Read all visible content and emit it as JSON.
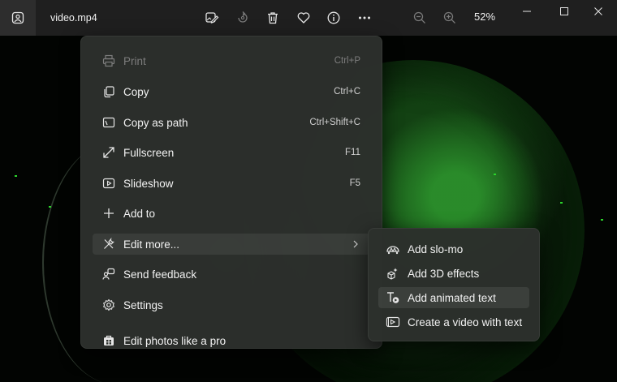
{
  "window": {
    "file_name": "video.mp4",
    "zoom_level": "52%"
  },
  "toolbar": {
    "icons": [
      "edit-image-icon",
      "rotate-icon",
      "delete-icon",
      "favorite-icon",
      "info-icon",
      "more-icon"
    ]
  },
  "menu": {
    "items": [
      {
        "label": "Print",
        "shortcut": "Ctrl+P",
        "icon": "printer-icon",
        "enabled": false
      },
      {
        "label": "Copy",
        "shortcut": "Ctrl+C",
        "icon": "copy-icon",
        "enabled": true
      },
      {
        "label": "Copy as path",
        "shortcut": "Ctrl+Shift+C",
        "icon": "path-icon",
        "enabled": true
      },
      {
        "label": "Fullscreen",
        "shortcut": "F11",
        "icon": "fullscreen-icon",
        "enabled": true
      },
      {
        "label": "Slideshow",
        "shortcut": "F5",
        "icon": "slideshow-icon",
        "enabled": true
      },
      {
        "label": "Add to",
        "shortcut": "",
        "icon": "plus-icon",
        "enabled": true
      },
      {
        "label": "Edit more...",
        "shortcut": "",
        "icon": "tools-icon",
        "enabled": true
      },
      {
        "label": "Send feedback",
        "shortcut": "",
        "icon": "feedback-icon",
        "enabled": true
      },
      {
        "label": "Settings",
        "shortcut": "",
        "icon": "settings-icon",
        "enabled": true
      },
      {
        "label": "Edit photos like a pro",
        "shortcut": "",
        "icon": "store-icon",
        "enabled": true
      }
    ]
  },
  "submenu": {
    "items": [
      {
        "label": "Add slo-mo",
        "icon": "slomo-icon"
      },
      {
        "label": "Add 3D effects",
        "icon": "effects-3d-icon"
      },
      {
        "label": "Add animated text",
        "icon": "animated-text-icon"
      },
      {
        "label": "Create a video with text",
        "icon": "video-text-icon"
      }
    ]
  }
}
